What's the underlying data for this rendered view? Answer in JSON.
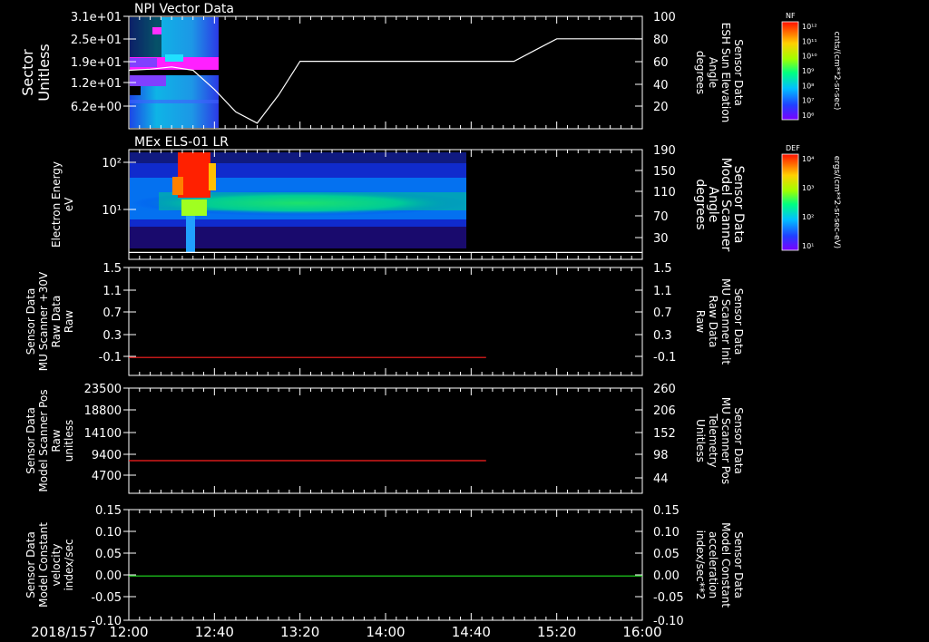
{
  "colors": {
    "background": "#000000",
    "foreground": "#ffffff",
    "red": "#ff2020",
    "green": "#20e020"
  },
  "footer": {
    "date_label": "2018/157"
  },
  "x_axis": {
    "tick_labels": [
      "12:00",
      "12:40",
      "13:20",
      "14:00",
      "14:40",
      "15:20",
      "16:00"
    ]
  },
  "chart_data": [
    {
      "id": "panel1",
      "type": "heatmap",
      "title": "NPI Vector Data",
      "ylabel": [
        "Sector",
        "Unitless"
      ],
      "yticks": [
        "3.1e+01",
        "2.5e+01",
        "1.9e+01",
        "1.2e+01",
        "6.2e+00"
      ],
      "right_ylabel": [
        "Sensor Data",
        "ESH Sun Elevation",
        "Angle",
        "degrees"
      ],
      "right_yticks": [
        "100",
        "80",
        "60",
        "40",
        "20"
      ],
      "right_ylim": [
        0,
        100
      ],
      "colorbar": {
        "label": "NF",
        "units": "cnts/(cm**2-sr-sec)",
        "ticks": [
          "10¹²",
          "10¹¹",
          "10¹⁰",
          "10⁹",
          "10⁸",
          "10⁷",
          "10⁶"
        ]
      },
      "line_series": {
        "name": "ESH Sun Elevation Angle",
        "color": "#ffffff",
        "x": [
          "12:00",
          "12:10",
          "12:20",
          "12:30",
          "12:40",
          "12:50",
          "13:00",
          "13:10",
          "13:20",
          "14:00",
          "14:40",
          "15:00",
          "15:10",
          "15:20",
          "16:00"
        ],
        "y": [
          52,
          53,
          55,
          52,
          35,
          15,
          5,
          30,
          60,
          60,
          60,
          60,
          70,
          80,
          80
        ]
      }
    },
    {
      "id": "panel2",
      "type": "heatmap",
      "title": "MEx ELS-01 LR",
      "ylabel": [
        "Electron Energy",
        "eV"
      ],
      "yticks": [
        "10²",
        "10¹"
      ],
      "right_ylabel": [
        "Sensor Data",
        "Model Scanner",
        "Angle",
        "degrees"
      ],
      "right_yticks": [
        "190",
        "150",
        "110",
        "70",
        "30"
      ],
      "right_ylim": [
        0,
        190
      ],
      "colorbar": {
        "label": "DEF",
        "units": "ergs/(cm**2-sr-sec-eV)",
        "ticks": [
          "10⁴",
          "10³",
          "10²",
          "10¹"
        ]
      },
      "line_series": {
        "name": "Model Scanner Angle",
        "color": "#ffffff",
        "x": [
          "12:00",
          "16:00"
        ],
        "y": [
          12,
          12
        ]
      }
    },
    {
      "id": "panel3",
      "type": "line",
      "ylabel": [
        "Sensor Data",
        "MU Scanner +30V",
        "Raw Data",
        "Raw"
      ],
      "yticks": [
        "1.5",
        "1.1",
        "0.7",
        "0.3",
        "-0.1"
      ],
      "ylim": [
        -0.3,
        1.5
      ],
      "right_ylabel": [
        "Sensor Data",
        "MU Scanner Init",
        "Raw Data",
        "Raw"
      ],
      "right_yticks": [
        "1.5",
        "1.1",
        "0.7",
        "0.3",
        "-0.1"
      ],
      "series": [
        {
          "color": "#ff2020",
          "x": [
            "12:00",
            "14:47"
          ],
          "y": [
            0,
            0
          ]
        }
      ]
    },
    {
      "id": "panel4",
      "type": "line",
      "ylabel": [
        "Sensor Data",
        "Model Scanner Pos",
        "Raw",
        "unitless"
      ],
      "yticks": [
        "23500",
        "18800",
        "14100",
        "9400",
        "4700"
      ],
      "ylim": [
        0,
        23500
      ],
      "right_ylabel": [
        "Sensor Data",
        "MU Scanner Pos",
        "Telemetry",
        "Unitless"
      ],
      "right_yticks": [
        "260",
        "206",
        "152",
        "98",
        "44"
      ],
      "series": [
        {
          "color": "#ff2020",
          "x": [
            "12:00",
            "14:47"
          ],
          "y": [
            7300,
            7300
          ]
        }
      ]
    },
    {
      "id": "panel5",
      "type": "line",
      "ylabel": [
        "Sensor Data",
        "Model Constant",
        "velocity",
        "index/sec"
      ],
      "yticks": [
        "0.15",
        "0.10",
        "0.05",
        "0.00",
        "-0.05",
        "-0.10"
      ],
      "ylim": [
        -0.1,
        0.15
      ],
      "right_ylabel": [
        "Sensor Data",
        "Model Constant",
        "acceleration",
        "index/sec**2"
      ],
      "right_yticks": [
        "0.15",
        "0.10",
        "0.05",
        "0.00",
        "-0.05",
        "-0.10"
      ],
      "series": [
        {
          "color": "#20e020",
          "x": [
            "12:00",
            "16:00"
          ],
          "y": [
            0,
            0
          ]
        }
      ]
    }
  ]
}
